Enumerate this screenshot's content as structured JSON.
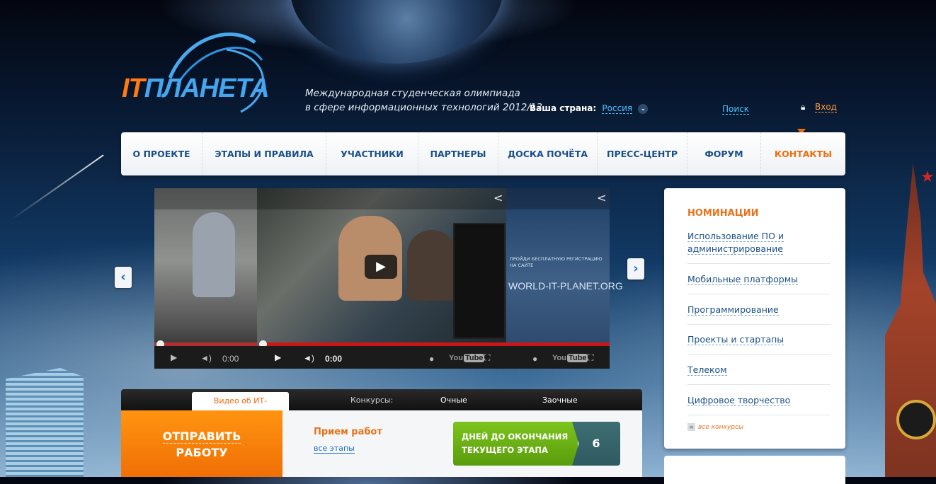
{
  "header": {
    "logo": {
      "it": "IT",
      "rest": "ПЛАНЕТА"
    },
    "tagline_line1": "Международная студенческая олимпиада",
    "tagline_line2": "в сфере информационных технологий 2012/13",
    "country_label": "Ваша страна:",
    "country_value": "Россия",
    "search_label": "Поиск",
    "login_label": "Вход"
  },
  "nav": {
    "items": [
      "О ПРОЕКТЕ",
      "ЭТАПЫ И ПРАВИЛА",
      "УЧАСТНИКИ",
      "ПАРТНЕРЫ",
      "ДОСКА ПОЧЁТА",
      "ПРЕСС-ЦЕНТР",
      "ФОРУМ",
      "КОНТАКТЫ"
    ],
    "active": "КОНТАКТЫ"
  },
  "video": {
    "left_time": "0:00",
    "main_time": "0:00",
    "overlay_text_small": "ПРОЙДИ БЕСПЛАТНУЮ РЕГИСТРАЦИЮ НА САЙТЕ",
    "overlay_text_url": "WORLD-IT-PLANET.ORG",
    "youtube_label": "You",
    "youtube_tube": "Tube"
  },
  "tabs": {
    "active": "Видео об ИТ-Олимпиаде",
    "contests_label": "Конкурсы:",
    "in_person": "Очные",
    "remote": "Заочные"
  },
  "send_work": {
    "line1": "ОТПРАВИТЬ",
    "line2": "РАБОТУ"
  },
  "stage": {
    "title": "Прием работ",
    "all_stages": "все этапы",
    "days_label_line1": "ДНЕЙ ДО ОКОНЧАНИЯ",
    "days_label_line2": "ТЕКУЩЕГО ЭТАПА",
    "days_value": "6"
  },
  "sidebar": {
    "title": "НОМИНАЦИИ",
    "items": [
      "Использование ПО и администрирование",
      "Мобильные платформы",
      "Программирование",
      "Проекты и стартапы",
      "Телеком",
      "Цифровое творчество"
    ],
    "all_contests": "все конкурсы"
  },
  "colors": {
    "accent_orange": "#ef6d0c",
    "link_blue": "#1a4f8a",
    "green": "#6fb517"
  }
}
